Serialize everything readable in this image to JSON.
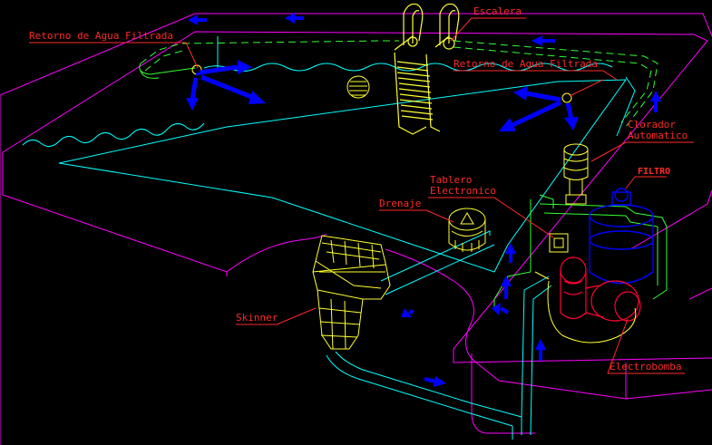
{
  "labels": {
    "escalera": "Escalera",
    "retorno_left": "Retorno de Agua Filtrada",
    "retorno_right": "Retorno de Agua Filtrada",
    "clorador_line1": "Clorador",
    "clorador_line2": "Automatico",
    "filtro": "FILTRO",
    "tablero_line1": "Tablero",
    "tablero_line2": "Electronico",
    "drenaje": "Drenaje",
    "skinner": "Skinner",
    "electrobomba": "Electrobomba"
  },
  "colors": {
    "background": "#000000",
    "pool_shell": "#ff00ff",
    "water_surface": "#00ffff",
    "pipe_green": "#33ff33",
    "fixture_yellow": "#ffff33",
    "flow_arrow": "#0000ff",
    "label_red": "#ff2a2a",
    "filter_body": "#0000ff",
    "pump_red": "#ff0033"
  },
  "icons": [
    "flow-arrow-icon",
    "return-nozzle-icon",
    "ladder-icon",
    "skimmer-icon",
    "drain-icon",
    "chlorinator-icon",
    "filter-tank-icon",
    "pump-motor-icon",
    "control-panel-icon"
  ]
}
